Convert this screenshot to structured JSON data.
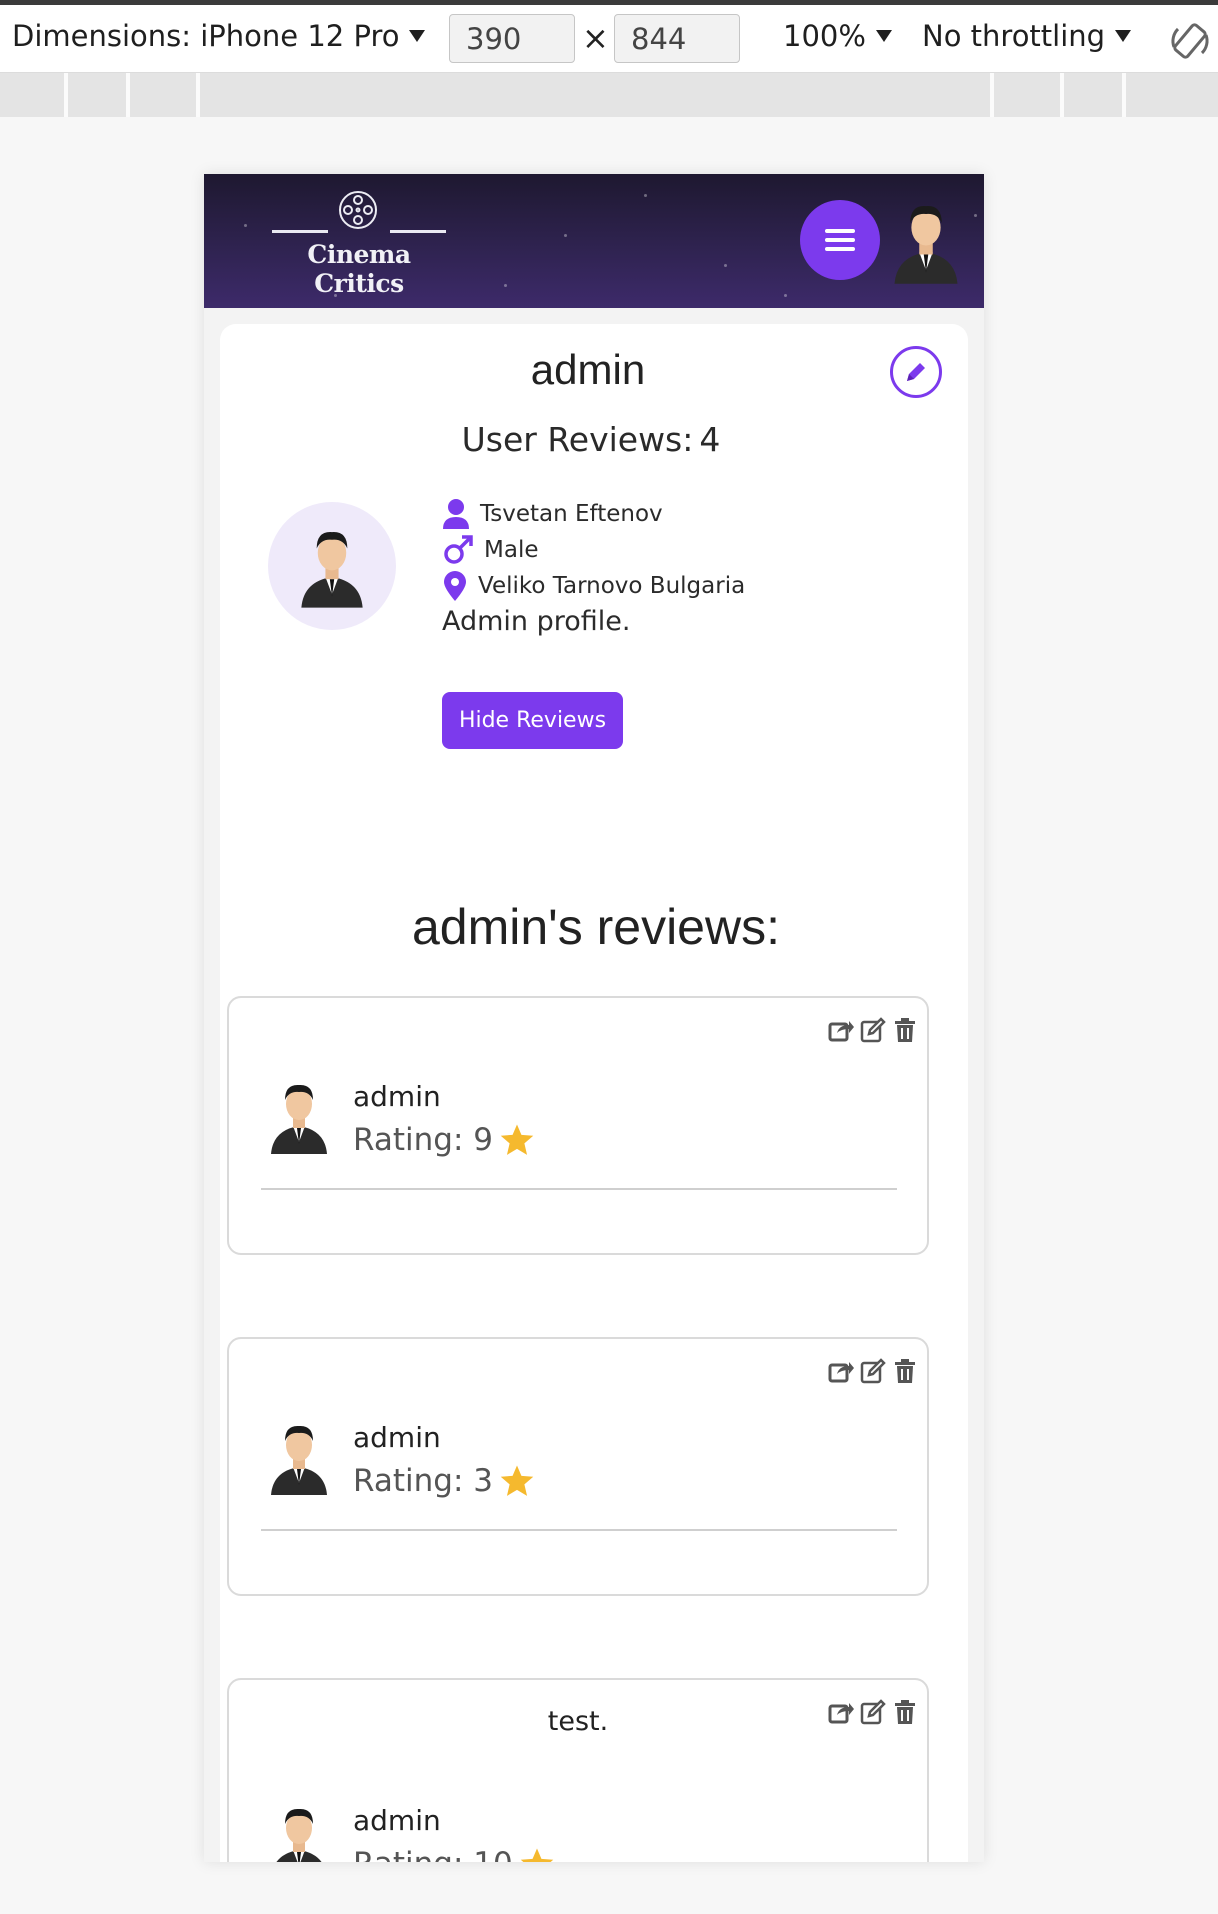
{
  "devtools": {
    "dimensions_label": "Dimensions: iPhone 12 Pro",
    "width_value": "390",
    "times": "×",
    "height_value": "844",
    "zoom": "100%",
    "throttling": "No throttling"
  },
  "header": {
    "logo_text": "Cinema Critics",
    "menu_icon": "hamburger-icon",
    "avatar_icon": "user-avatar-icon"
  },
  "profile": {
    "username": "admin",
    "reviews_label": "User Reviews:",
    "reviews_count": "4",
    "full_name": "Tsvetan Eftenov",
    "gender": "Male",
    "location": "Veliko Tarnovo Bulgaria",
    "bio": "Admin profile.",
    "hide_reviews_label": "Hide Reviews",
    "accent_color": "#7c3aed"
  },
  "reviews_section": {
    "title": "admin's reviews:",
    "reviews": [
      {
        "text": "",
        "author": "admin",
        "rating_label": "Rating:",
        "rating": "9"
      },
      {
        "text": "",
        "author": "admin",
        "rating_label": "Rating:",
        "rating": "3"
      },
      {
        "text": "test.",
        "author": "admin",
        "rating_label": "Rating:",
        "rating": "10"
      }
    ]
  }
}
